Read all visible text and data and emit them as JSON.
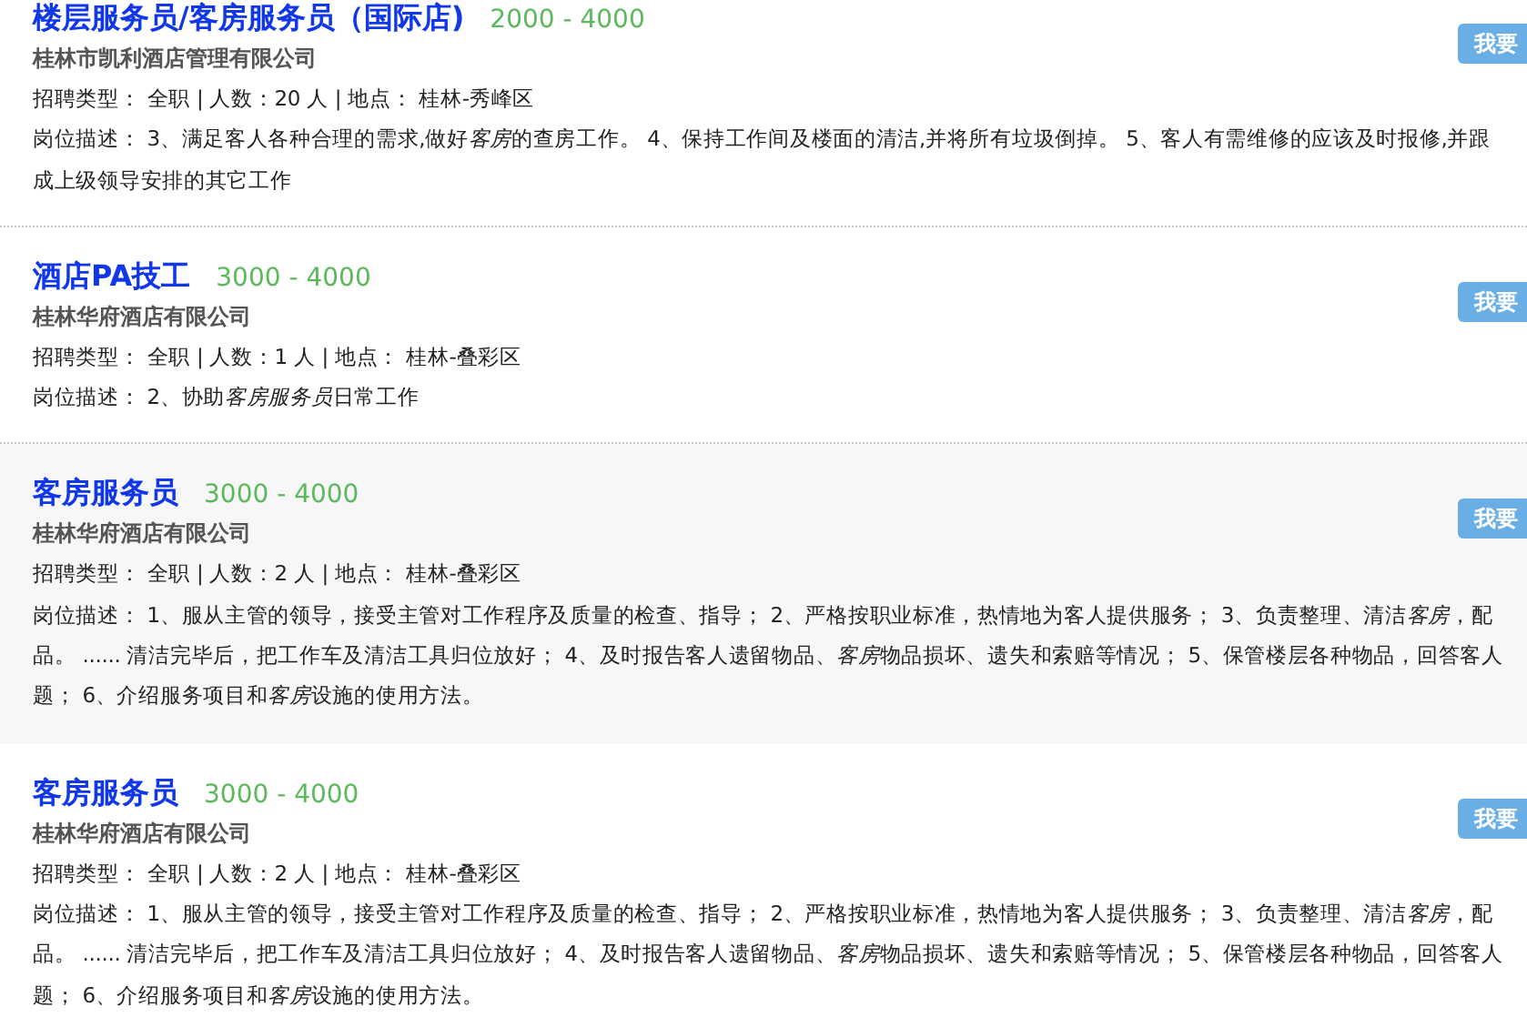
{
  "jobs": [
    {
      "title": "楼层服务员/客房服务员（国际店)",
      "salary": "2000 - 4000",
      "company": "桂林市凯利酒店管理有限公司",
      "meta": "招聘类型： 全职 | 人数：20 人 | 地点： 桂林-秀峰区",
      "description": [
        [
          {
            "text": "岗位描述： 3、满足客人各种合理的需求,做好",
            "italic": false
          },
          {
            "text": "客房",
            "italic": true
          },
          {
            "text": "的查房工作。 4、保持工作间及楼面的清洁,并将所有垃圾倒掉。 5、客人有需维修的应该及时报修,并跟",
            "italic": false
          }
        ],
        [
          {
            "text": "成上级领导安排的其它工作",
            "italic": false
          }
        ]
      ],
      "button": "我要",
      "highlighted": false
    },
    {
      "title": "酒店PA技工",
      "salary": "3000 - 4000",
      "company": "桂林华府酒店有限公司",
      "meta": "招聘类型： 全职 | 人数：1 人 | 地点： 桂林-叠彩区",
      "description": [
        [
          {
            "text": "岗位描述： 2、协助",
            "italic": false
          },
          {
            "text": "客房服务员",
            "italic": true
          },
          {
            "text": "日常工作",
            "italic": false
          }
        ]
      ],
      "button": "我要",
      "highlighted": false
    },
    {
      "title": "客房服务员",
      "salary": "3000 - 4000",
      "company": "桂林华府酒店有限公司",
      "meta": "招聘类型： 全职 | 人数：2 人 | 地点： 桂林-叠彩区",
      "description": [
        [
          {
            "text": "岗位描述： 1、服从主管的领导，接受主管对工作程序及质量的检查、指导； 2、严格按职业标准，热情地为客人提供服务； 3、负责整理、清洁",
            "italic": false
          },
          {
            "text": "客房",
            "italic": true
          },
          {
            "text": "，配",
            "italic": false
          }
        ],
        [
          {
            "text": "品。 ...... 清洁完毕后，把工作车及清洁工具归位放好； 4、及时报告客人遗留物品、",
            "italic": false
          },
          {
            "text": "客房",
            "italic": true
          },
          {
            "text": "物品损坏、遗失和索赔等情况； 5、保管楼层各种物品，回答客人",
            "italic": false
          }
        ],
        [
          {
            "text": "题； 6、介绍服务项目和",
            "italic": false
          },
          {
            "text": "客房",
            "italic": true
          },
          {
            "text": "设施的使用方法。",
            "italic": false
          }
        ]
      ],
      "button": "我要",
      "highlighted": true
    },
    {
      "title": "客房服务员",
      "salary": "3000 - 4000",
      "company": "桂林华府酒店有限公司",
      "meta": "招聘类型： 全职 | 人数：2 人 | 地点： 桂林-叠彩区",
      "description": [
        [
          {
            "text": "岗位描述： 1、服从主管的领导，接受主管对工作程序及质量的检查、指导； 2、严格按职业标准，热情地为客人提供服务； 3、负责整理、清洁",
            "italic": false
          },
          {
            "text": "客房",
            "italic": true
          },
          {
            "text": "，配",
            "italic": false
          }
        ],
        [
          {
            "text": "品。 ...... 清洁完毕后，把工作车及清洁工具归位放好； 4、及时报告客人遗留物品、",
            "italic": false
          },
          {
            "text": "客房",
            "italic": true
          },
          {
            "text": "物品损坏、遗失和索赔等情况； 5、保管楼层各种物品，回答客人",
            "italic": false
          }
        ],
        [
          {
            "text": "题； 6、介绍服务项目和",
            "italic": false
          },
          {
            "text": "客房",
            "italic": true
          },
          {
            "text": "设施的使用方法。",
            "italic": false
          }
        ]
      ],
      "button": "我要",
      "highlighted": false
    }
  ]
}
